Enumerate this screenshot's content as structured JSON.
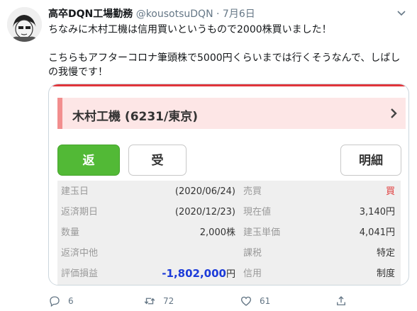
{
  "tweet": {
    "author_name": "高卒DQN工場勤務",
    "author_handle": "@kousotsuDQN",
    "separator": "·",
    "date": "7月6日",
    "text_line1": "ちなみに木村工機は信用買いというもので2000株買いました！",
    "text_line2": "こちらもアフターコロナ筆頭株で5000円くらいまでは行くそうなんで、しばしの我慢です！"
  },
  "card": {
    "stock_title": "木村工機 (6231/東京)",
    "buttons": {
      "return": "返",
      "receive": "受",
      "detail": "明細"
    },
    "rows": [
      {
        "left_label": "建玉日",
        "left_value": "(2020/06/24)",
        "right_label": "売買",
        "right_value": "買"
      },
      {
        "left_label": "返済期日",
        "left_value": "(2020/12/23)",
        "right_label": "現在値",
        "right_value": "3,140円"
      },
      {
        "left_label": "数量",
        "left_value": "2,000株",
        "right_label": "建玉単価",
        "right_value": "4,041円"
      },
      {
        "left_label": "返済中他",
        "left_value": "",
        "right_label": "課税",
        "right_value": "特定"
      },
      {
        "left_label": "評価損益",
        "left_value": "-1,802,000",
        "left_unit": "円",
        "right_label": "信用",
        "right_value": "制度"
      }
    ],
    "colors": {
      "accent_red": "#e1353b",
      "buy_red": "#e03a3a",
      "loss_blue": "#1c3bd9",
      "button_green": "#52b936"
    }
  },
  "actions": {
    "reply_count": "6",
    "retweet_count": "72",
    "like_count": "61"
  },
  "icons": [
    "avatar-image",
    "chevron-down-icon",
    "chevron-right-icon",
    "reply-icon",
    "retweet-icon",
    "like-icon",
    "share-icon"
  ]
}
